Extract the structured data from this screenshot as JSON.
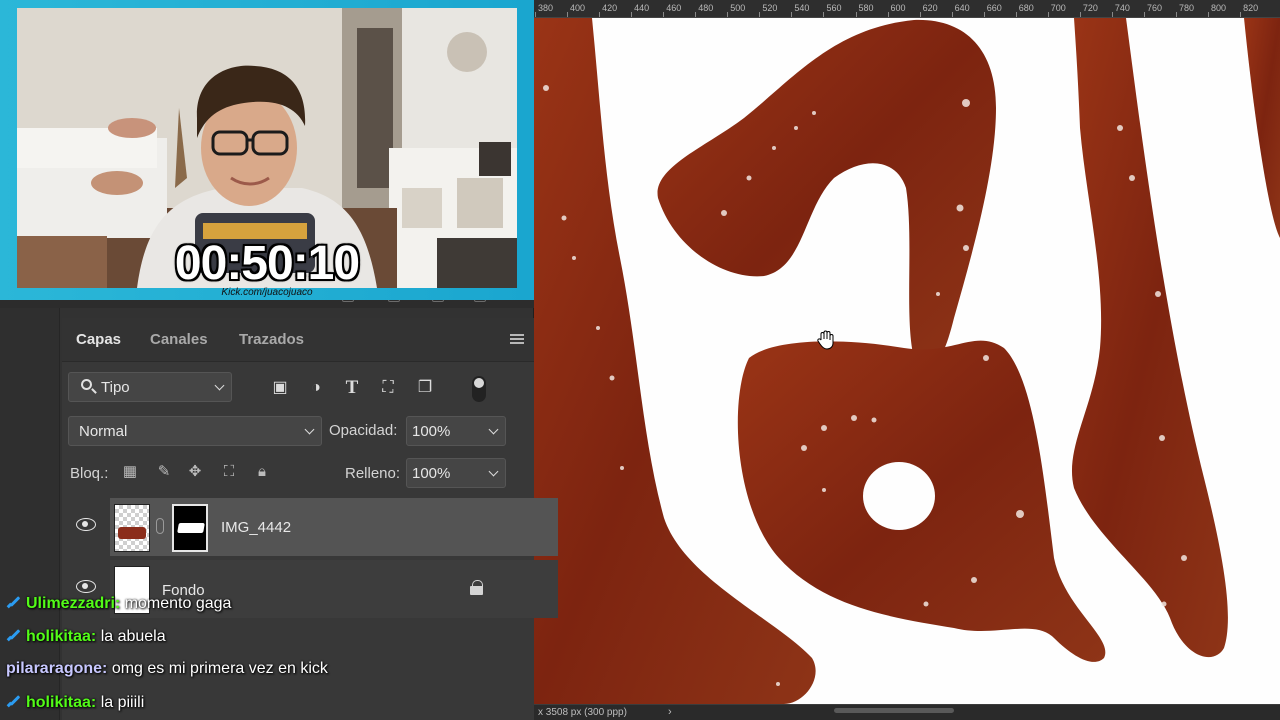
{
  "webcam": {
    "timer": "00:50:10",
    "url": "Kick.com/juacojuaco"
  },
  "ruler": {
    "ticks": [
      "380",
      "400",
      "420",
      "440",
      "460",
      "480",
      "500",
      "520",
      "540",
      "560",
      "580",
      "600",
      "620",
      "640",
      "660",
      "680",
      "700",
      "720",
      "740",
      "760",
      "780",
      "800",
      "820"
    ]
  },
  "status_bar": {
    "text": "x 3508 px (300 ppp)",
    "chevron": "›"
  },
  "layers_panel": {
    "tabs": [
      {
        "label": "Capas",
        "active": true
      },
      {
        "label": "Canales",
        "active": false
      },
      {
        "label": "Trazados",
        "active": false
      }
    ],
    "filter": {
      "kind_value": "Tipo",
      "icons": [
        "image-filter-icon",
        "adjustment-filter-icon",
        "type-filter-icon",
        "shape-filter-icon",
        "smart-object-filter-icon"
      ]
    },
    "blend_mode": "Normal",
    "opacity_label": "Opacidad:",
    "opacity_value": "100%",
    "lock_label": "Bloq.:",
    "fill_label": "Relleno:",
    "fill_value": "100%",
    "layers": [
      {
        "name": "IMG_4442",
        "selected": true,
        "visible": true,
        "has_mask": true
      },
      {
        "name": "Fondo",
        "selected": false,
        "visible": true,
        "locked": true
      }
    ]
  },
  "chat": {
    "messages": [
      {
        "user": "Ulimezzadri:",
        "text": "momento gaga",
        "user_color": "#53fc18",
        "badge": true
      },
      {
        "user": "holikitaa:",
        "text": "la abuela",
        "user_color": "#53fc18",
        "badge": true
      },
      {
        "user": "pilararagone:",
        "text": "omg es mi primera vez en kick",
        "user_color": "#c8c8ff",
        "badge": false
      },
      {
        "user": "holikitaa:",
        "text": "la piiili",
        "user_color": "#53fc18",
        "badge": true
      }
    ]
  },
  "canvas": {
    "tool_cursor": "hand-tool-cursor-icon",
    "artwork_color": "#8a2a12"
  }
}
